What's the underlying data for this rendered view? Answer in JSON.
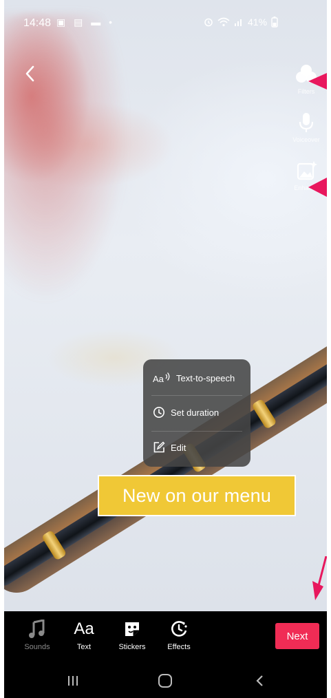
{
  "status": {
    "time": "14:48",
    "left_icons": "▣ ▤ ▬ •",
    "battery": "41%"
  },
  "tools": [
    {
      "label": "Filters",
      "icon": "filters-icon"
    },
    {
      "label": "Voiceover",
      "icon": "microphone-icon"
    },
    {
      "label": "Enhance",
      "icon": "enhance-image-icon"
    }
  ],
  "popup": {
    "items": [
      {
        "label": "Text-to-speech",
        "icon": "text-to-speech-icon"
      },
      {
        "label": "Set duration",
        "icon": "clock-icon"
      },
      {
        "label": "Edit",
        "icon": "edit-icon"
      }
    ]
  },
  "caption": {
    "text": "New on our menu"
  },
  "bottom": {
    "sounds": "Sounds",
    "text": "Text",
    "text_icon": "Aa",
    "stickers": "Stickers",
    "effects": "Effects",
    "next": "Next"
  },
  "colors": {
    "accent": "#f02c55",
    "caption_bg": "#f0c836",
    "annotation_arrow": "#e8175d"
  }
}
